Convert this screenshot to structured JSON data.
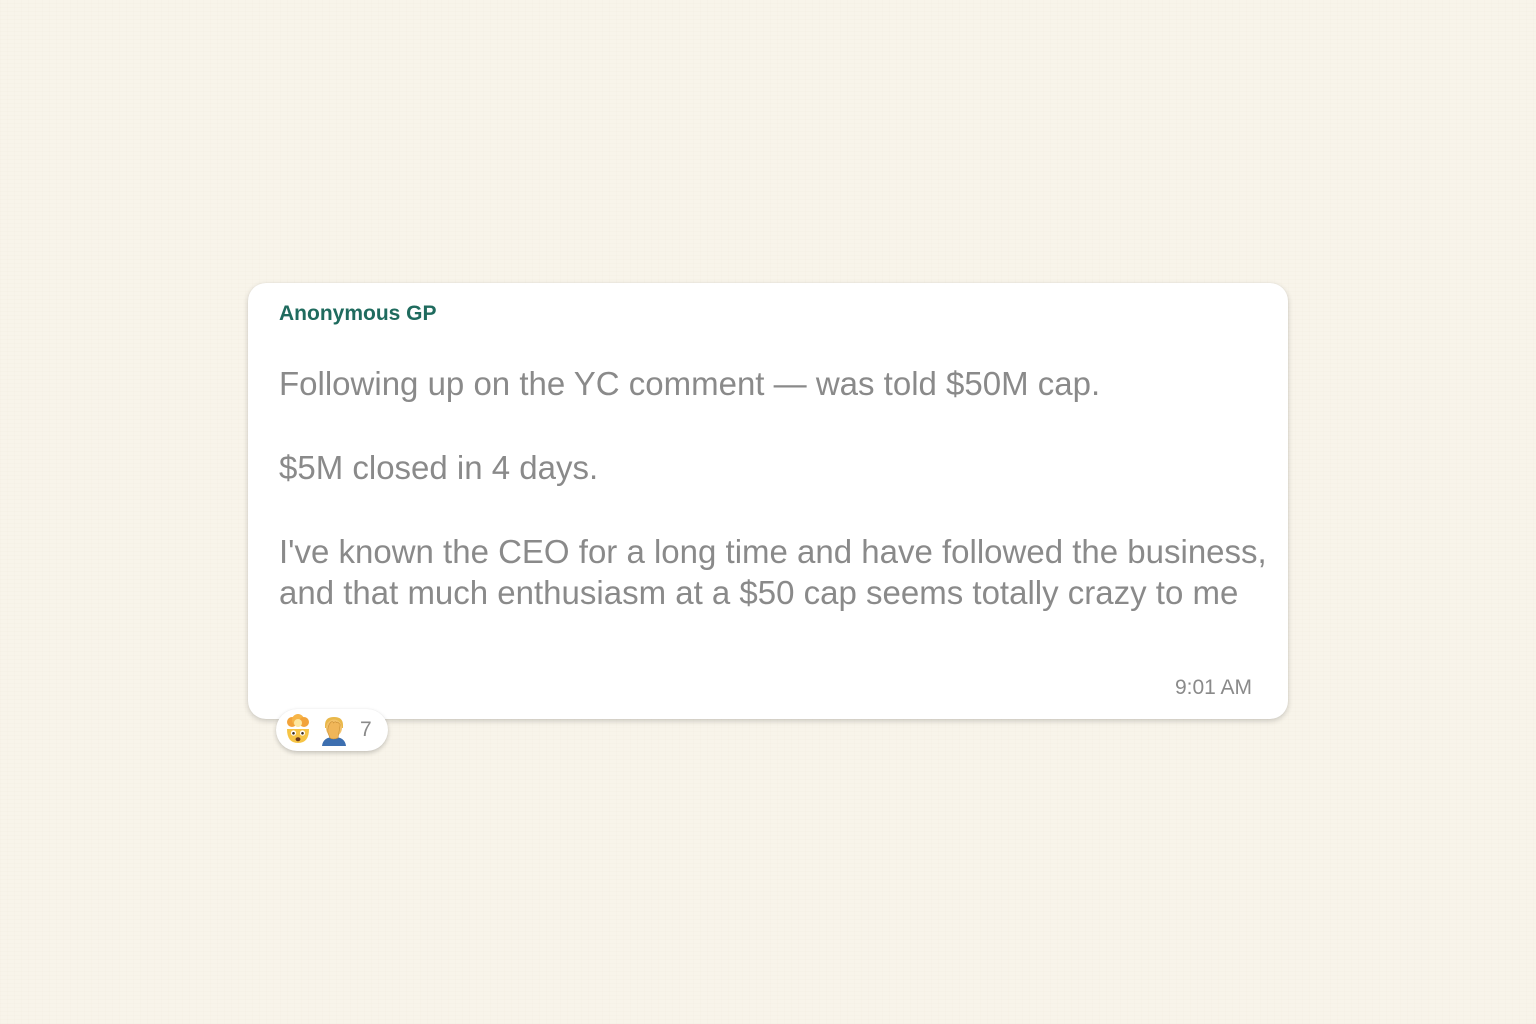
{
  "message": {
    "sender": "Anonymous GP",
    "paragraphs": [
      "Following up on the YC comment — was told $50M cap.",
      "$5M closed in 4 days.",
      "I've known the CEO for a long time and have followed the business, and that much enthusiasm at a $50 cap seems totally crazy to me"
    ],
    "timestamp": "9:01 AM"
  },
  "reactions": {
    "emojis": [
      "exploding-head-icon",
      "facepalm-icon"
    ],
    "count": "7"
  },
  "colors": {
    "sender": "#1f6b5e",
    "body_text": "#8a8a8a",
    "background": "#f8f4ea",
    "bubble": "#ffffff"
  }
}
